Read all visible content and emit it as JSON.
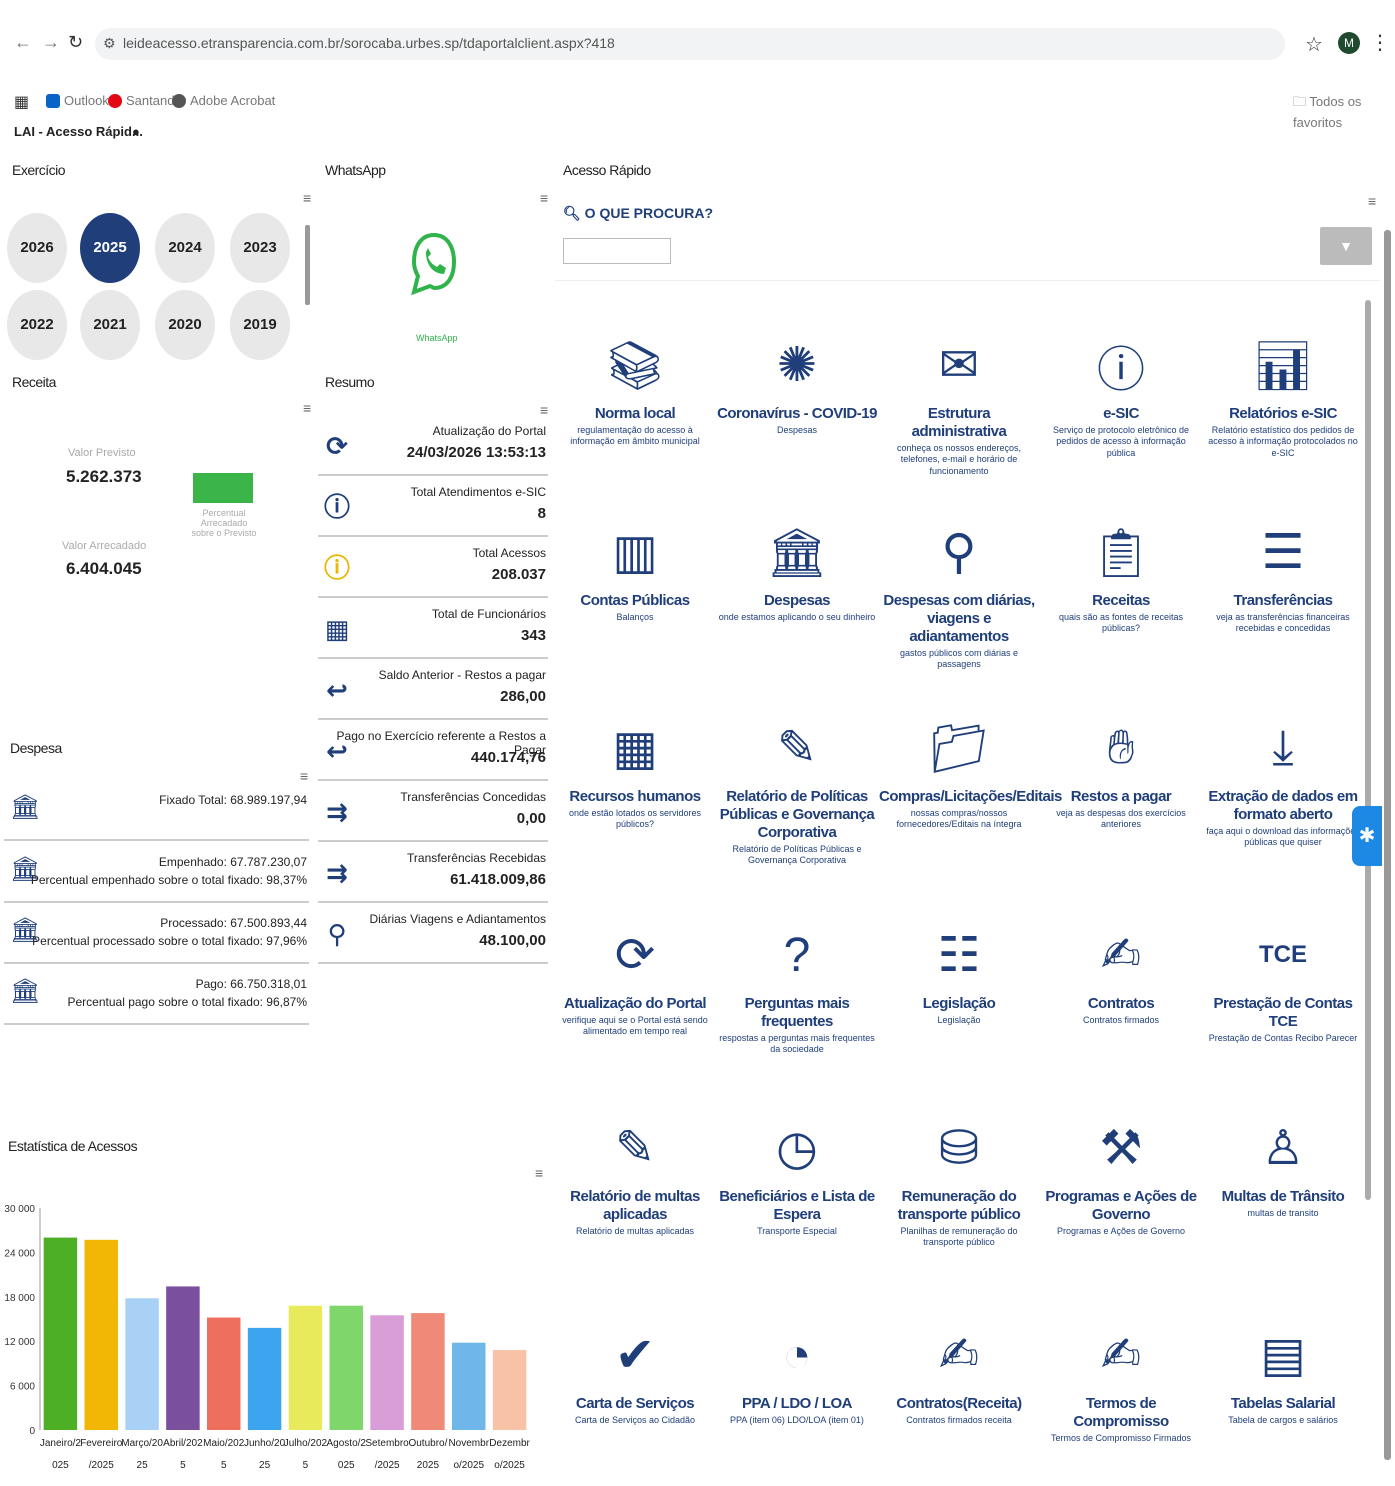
{
  "browser": {
    "url": "leideacesso.etransparencia.com.br/sorocaba.urbes.sp/tdaportalclient.aspx?418",
    "bookmarks": [
      "Outlook",
      "Santander",
      "Adobe Acrobat"
    ],
    "all_favorites": "Todos os favoritos",
    "avatar_letter": "M"
  },
  "page_tab": "LAI - Acesso Rápid...",
  "exercicio": {
    "title": "Exercício",
    "years": [
      "2026",
      "2025",
      "2024",
      "2023",
      "2022",
      "2021",
      "2020",
      "2019"
    ],
    "selected": "2025"
  },
  "whatsapp": {
    "title": "WhatsApp",
    "caption": "WhatsApp"
  },
  "receita": {
    "title": "Receita",
    "previsto_label": "Valor Previsto",
    "previsto_value": "5.262.373",
    "arrecadado_label": "Valor Arrecadado",
    "arrecadado_value": "6.404.045",
    "percent_label": "Percentual Arrecadado sobre o Previsto"
  },
  "resumo": {
    "title": "Resumo",
    "rows": [
      {
        "icon": "refresh-icon",
        "label": "Atualização do Portal",
        "value": "24/03/2026 13:53:13"
      },
      {
        "icon": "info-icon",
        "label": "Total Atendimentos e-SIC",
        "value": "8"
      },
      {
        "icon": "info-yellow-icon",
        "label": "Total Acessos",
        "value": "208.037"
      },
      {
        "icon": "employees-icon",
        "label": "Total de Funcionários",
        "value": "343"
      },
      {
        "icon": "money-return-icon",
        "label": "Saldo Anterior - Restos a pagar",
        "value": "286,00"
      },
      {
        "icon": "money-return-icon",
        "label": "Pago no Exercício referente a Restos a Pagar",
        "value": "440.174,76"
      },
      {
        "icon": "transfer-icon",
        "label": "Transferências Concedidas",
        "value": "0,00"
      },
      {
        "icon": "transfer-icon",
        "label": "Transferências Recebidas",
        "value": "61.418.009,86"
      },
      {
        "icon": "travel-icon",
        "label": "Diárias Viagens e Adiantamentos",
        "value": "48.100,00"
      }
    ]
  },
  "despesa": {
    "title": "Despesa",
    "rows": [
      {
        "line1": "Fixado Total: 68.989.197,94",
        "line2": ""
      },
      {
        "line1": "Empenhado: 67.787.230,07",
        "line2": "Percentual empenhado sobre o total fixado: 98,37%"
      },
      {
        "line1": "Processado: 67.500.893,44",
        "line2": "Percentual processado sobre o total fixado: 97,96%"
      },
      {
        "line1": "Pago: 66.750.318,01",
        "line2": "Percentual pago sobre o total fixado: 96,87%"
      }
    ]
  },
  "acesso_rapido": {
    "title": "Acesso Rápido",
    "search_label": "O QUE PROCURA?",
    "filter_label": "Filtrar",
    "tiles": [
      {
        "icon": "books-icon",
        "title": "Norma local",
        "desc": "regulamentação do acesso à informação em âmbito municipal"
      },
      {
        "icon": "virus-icon",
        "title": "Coronavírus - COVID-19",
        "desc": "Despesas"
      },
      {
        "icon": "envelope-icon",
        "title": "Estrutura administrativa",
        "desc": "conheça os nossos endereços, telefones, e-mail e horário de funcionamento"
      },
      {
        "icon": "info-bubble-icon",
        "title": "e-SIC",
        "desc": "Serviço de protocolo eletrônico de pedidos de acesso à informação pública"
      },
      {
        "icon": "report-search-icon",
        "title": "Relatórios e-SIC",
        "desc": "Relatório estatístico dos pedidos de acesso à informação protocolados no e-SIC"
      },
      {
        "icon": "accounts-icon",
        "title": "Contas Públicas",
        "desc": "Balanços"
      },
      {
        "icon": "expenses-icon",
        "title": "Despesas",
        "desc": "onde estamos aplicando o seu dinheiro"
      },
      {
        "icon": "route-icon",
        "title": "Despesas com diárias, viagens e adiantamentos",
        "desc": "gastos públicos com diárias e passagens"
      },
      {
        "icon": "clipboard-money-icon",
        "title": "Receitas",
        "desc": "quais são as fontes de receitas públicas?"
      },
      {
        "icon": "transfer-list-icon",
        "title": "Transferências",
        "desc": "veja as transferências financeiras recebidas e concedidas"
      },
      {
        "icon": "building-people-icon",
        "title": "Recursos humanos",
        "desc": "onde estão lotados os servidores públicos?"
      },
      {
        "icon": "notepad-pen-icon",
        "title": "Relatório de Políticas Públicas e Governança Corporativa",
        "desc": "Relatório de Políticas Públicas e Governança Corporativa"
      },
      {
        "icon": "folder-icon",
        "title": "Compras/Licitações/Editais",
        "desc": "nossas compras/nossos fornecedores/Editais na íntegra"
      },
      {
        "icon": "money-hand-icon",
        "title": "Restos a pagar",
        "desc": "veja as despesas dos exercícios anteriores"
      },
      {
        "icon": "download-icon",
        "title": "Extração de dados em formato aberto",
        "desc": "faça aqui o download das informações públicas que quiser"
      },
      {
        "icon": "refresh-clock-icon",
        "title": "Atualização do Portal",
        "desc": "verifique aqui se o Portal está sendo alimentado em tempo real"
      },
      {
        "icon": "question-icon",
        "title": "Perguntas mais frequentes",
        "desc": "respostas a perguntas mais frequentes da sociedade"
      },
      {
        "icon": "list-search-icon",
        "title": "Legislação",
        "desc": "Legislação"
      },
      {
        "icon": "contract-pen-icon",
        "title": "Contratos",
        "desc": "Contratos firmados"
      },
      {
        "icon": "tce-icon",
        "title": "Prestação de Contas TCE",
        "desc": "Prestação de Contas Recibo Parecer"
      },
      {
        "icon": "fine-report-icon",
        "title": "Relatório de multas aplicadas",
        "desc": "Relatório de multas aplicadas"
      },
      {
        "icon": "waiting-clock-icon",
        "title": "Beneficiários e Lista de Espera",
        "desc": "Transporte Especial"
      },
      {
        "icon": "coins-hand-icon",
        "title": "Remuneração do transporte público",
        "desc": "Planilhas de remuneração do transporte público"
      },
      {
        "icon": "building-tools-icon",
        "title": "Programas e Ações de Governo",
        "desc": "Programas e Ações de Governo"
      },
      {
        "icon": "officer-icon",
        "title": "Multas de Trânsito",
        "desc": "multas de transito"
      },
      {
        "icon": "check-card-icon",
        "title": "Carta de Serviços",
        "desc": "Carta de Serviços ao Cidadão"
      },
      {
        "icon": "pie-coins-icon",
        "title": "PPA / LDO / LOA",
        "desc": "PPA (item 06) LDO/LOA (item 01)"
      },
      {
        "icon": "contract-pen-icon",
        "title": "Contratos(Receita)",
        "desc": "Contratos firmados receita"
      },
      {
        "icon": "contract-pen-icon",
        "title": "Termos de Compromisso",
        "desc": "Termos de Compromisso Firmados"
      },
      {
        "icon": "salary-table-icon",
        "title": "Tabelas Salarial",
        "desc": "Tabela de cargos e salários"
      }
    ]
  },
  "estatistica": {
    "title": "Estatística de Acessos"
  },
  "chart_data": {
    "type": "bar",
    "title": "Estatística de Acessos",
    "categories": [
      "Janeiro/2025",
      "Fevereiro/2025",
      "Março/2025",
      "Abril/2025",
      "Maio/2025",
      "Junho/2025",
      "Julho/2025",
      "Agosto/2025",
      "Setembro/2025",
      "Outubro/2025",
      "Novembro/2025",
      "Dezembro/2025"
    ],
    "tick_labels_line1": [
      "Janeiro/2",
      "Fevereiro",
      "Março/20",
      "Abril/202",
      "Maio/202",
      "Junho/20",
      "Julho/202",
      "Agosto/2",
      "Setembro",
      "Outubro/",
      "Novembr",
      "Dezembr"
    ],
    "tick_labels_line2": [
      "025",
      "/2025",
      "25",
      "5",
      "5",
      "25",
      "5",
      "025",
      "/2025",
      "2025",
      "o/2025",
      "o/2025"
    ],
    "values": [
      26000,
      25700,
      17800,
      19400,
      15200,
      13800,
      16800,
      16800,
      15500,
      15800,
      11800,
      10800
    ],
    "colors": [
      "#4caf26",
      "#f2b705",
      "#a9d1f5",
      "#7a4f9e",
      "#ef6f5e",
      "#3da5ef",
      "#e8ea5b",
      "#7fd66b",
      "#d99dd8",
      "#f08a78",
      "#6fb7e8",
      "#f7c2a5"
    ],
    "yticks": [
      "0",
      "6 000",
      "12 000",
      "18 000",
      "24 000",
      "30 000"
    ],
    "ylim": [
      0,
      30000
    ]
  }
}
